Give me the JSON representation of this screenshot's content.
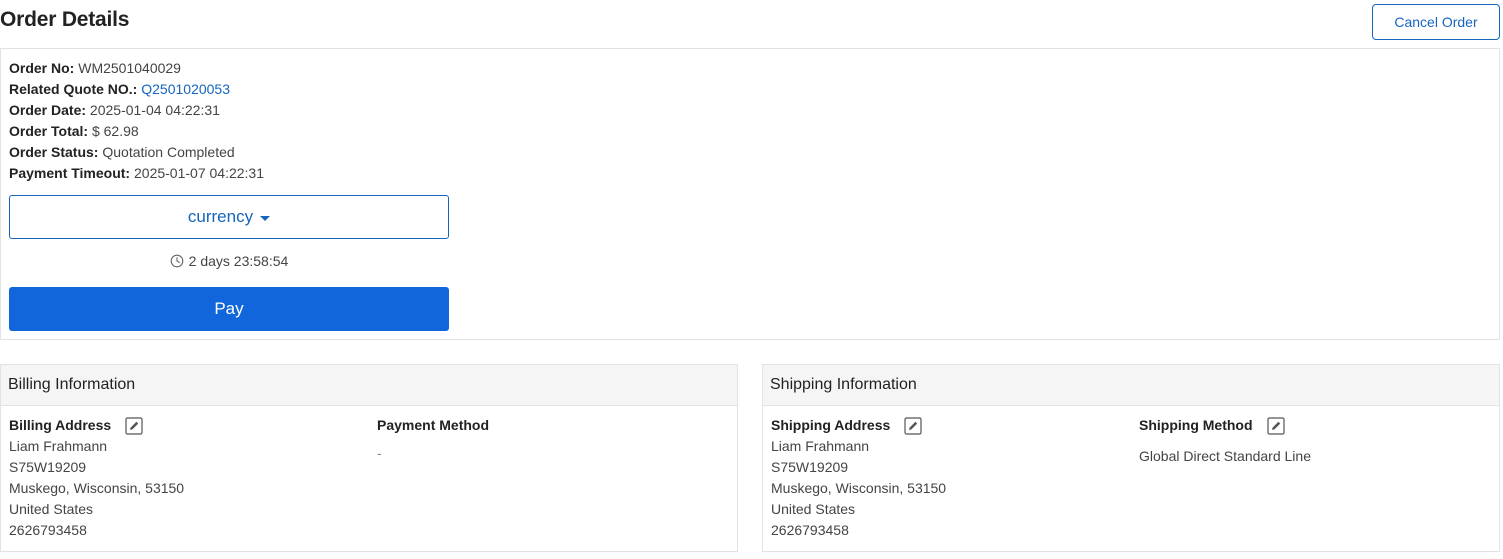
{
  "header": {
    "title": "Order Details",
    "cancel_label": "Cancel Order"
  },
  "order": {
    "fields": [
      {
        "label": "Order No:",
        "value": "WM2501040029"
      },
      {
        "label": "Related Quote NO.:",
        "value": "Q2501020053"
      },
      {
        "label": "Order Date:",
        "value": "2025-01-04 04:22:31"
      },
      {
        "label": "Order Total:",
        "value": "$ 62.98"
      },
      {
        "label": "Order Status:",
        "value": "Quotation Completed"
      },
      {
        "label": "Payment Timeout:",
        "value": "2025-01-07 04:22:31"
      }
    ],
    "currency_label": "currency",
    "countdown": "2 days 23:58:54",
    "pay_label": "Pay"
  },
  "billing": {
    "title": "Billing Information",
    "address_title": "Billing Address",
    "address_lines": [
      "Liam Frahmann",
      "S75W19209",
      "Muskego, Wisconsin, 53150",
      "United States",
      "2626793458"
    ],
    "payment_method_title": "Payment Method",
    "payment_method_value": "-"
  },
  "shipping": {
    "title": "Shipping Information",
    "address_title": "Shipping Address",
    "address_lines": [
      "Liam Frahmann",
      "S75W19209",
      "Muskego, Wisconsin, 53150",
      "United States",
      "2626793458"
    ],
    "method_title": "Shipping Method",
    "method_value": "Global Direct Standard Line"
  },
  "icons": {
    "clock": "clock-icon",
    "edit": "edit-icon",
    "caret": "caret-down-icon"
  },
  "colors": {
    "accent": "#1565c0",
    "pay_button": "#1266dc",
    "panel_header_bg": "#f5f5f5",
    "border": "#e3e3e3"
  }
}
